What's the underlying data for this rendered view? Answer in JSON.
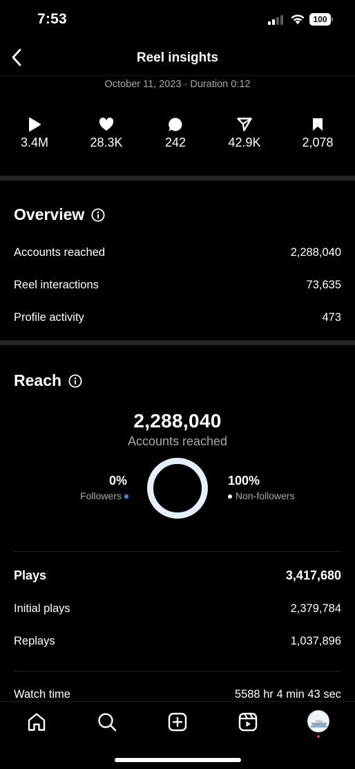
{
  "status": {
    "time": "7:53",
    "battery": "100"
  },
  "header": {
    "title": "Reel insights",
    "subline": "October 11, 2023 · Duration 0:12"
  },
  "metrics": [
    {
      "icon": "play-icon",
      "value": "3.4M"
    },
    {
      "icon": "heart-icon",
      "value": "28.3K"
    },
    {
      "icon": "comment-icon",
      "value": "242"
    },
    {
      "icon": "share-icon",
      "value": "42.9K"
    },
    {
      "icon": "bookmark-icon",
      "value": "2,078"
    }
  ],
  "overview": {
    "title": "Overview",
    "rows": [
      {
        "label": "Accounts reached",
        "value": "2,288,040"
      },
      {
        "label": "Reel interactions",
        "value": "73,635"
      },
      {
        "label": "Profile activity",
        "value": "473"
      }
    ]
  },
  "reach": {
    "title": "Reach",
    "total": "2,288,040",
    "total_label": "Accounts reached",
    "followers_pct": "0%",
    "followers_label": "Followers",
    "followers_fraction": 0,
    "nonfollowers_pct": "100%",
    "nonfollowers_label": "Non-followers",
    "followers_color": "#3797f0",
    "nonfollowers_color": "#e3f0fc"
  },
  "plays": {
    "label": "Plays",
    "value": "3,417,680",
    "rows": [
      {
        "label": "Initial plays",
        "value": "2,379,784"
      },
      {
        "label": "Replays",
        "value": "1,037,896"
      }
    ]
  },
  "watch_time": {
    "label": "Watch time",
    "value": "5588 hr 4 min 43 sec"
  },
  "nav": [
    "home-icon",
    "search-icon",
    "create-icon",
    "reels-icon",
    "profile-avatar"
  ]
}
